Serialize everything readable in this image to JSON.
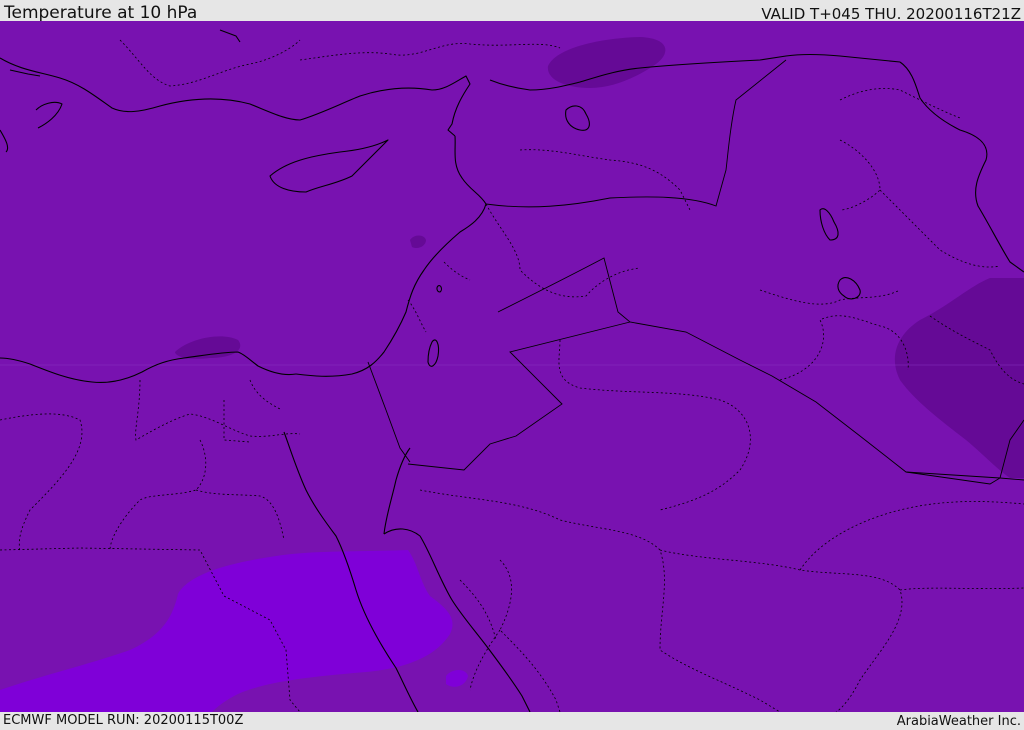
{
  "header": {
    "title": "Temperature at 10 hPa",
    "valid": "VALID T+045 THU. 20200116T21Z"
  },
  "footer": {
    "model_run": "ECMWF MODEL RUN: 20200115T00Z",
    "credit": "ArabiaWeather Inc."
  },
  "colors": {
    "base_field": "#7812b0",
    "cold_patch": "#650a96",
    "warm_patch": "#7f00d8",
    "coastline": "#000000",
    "border": "#000000"
  },
  "map": {
    "icons": [
      "coastline-layer",
      "international-border-layer",
      "province-border-layer"
    ]
  }
}
